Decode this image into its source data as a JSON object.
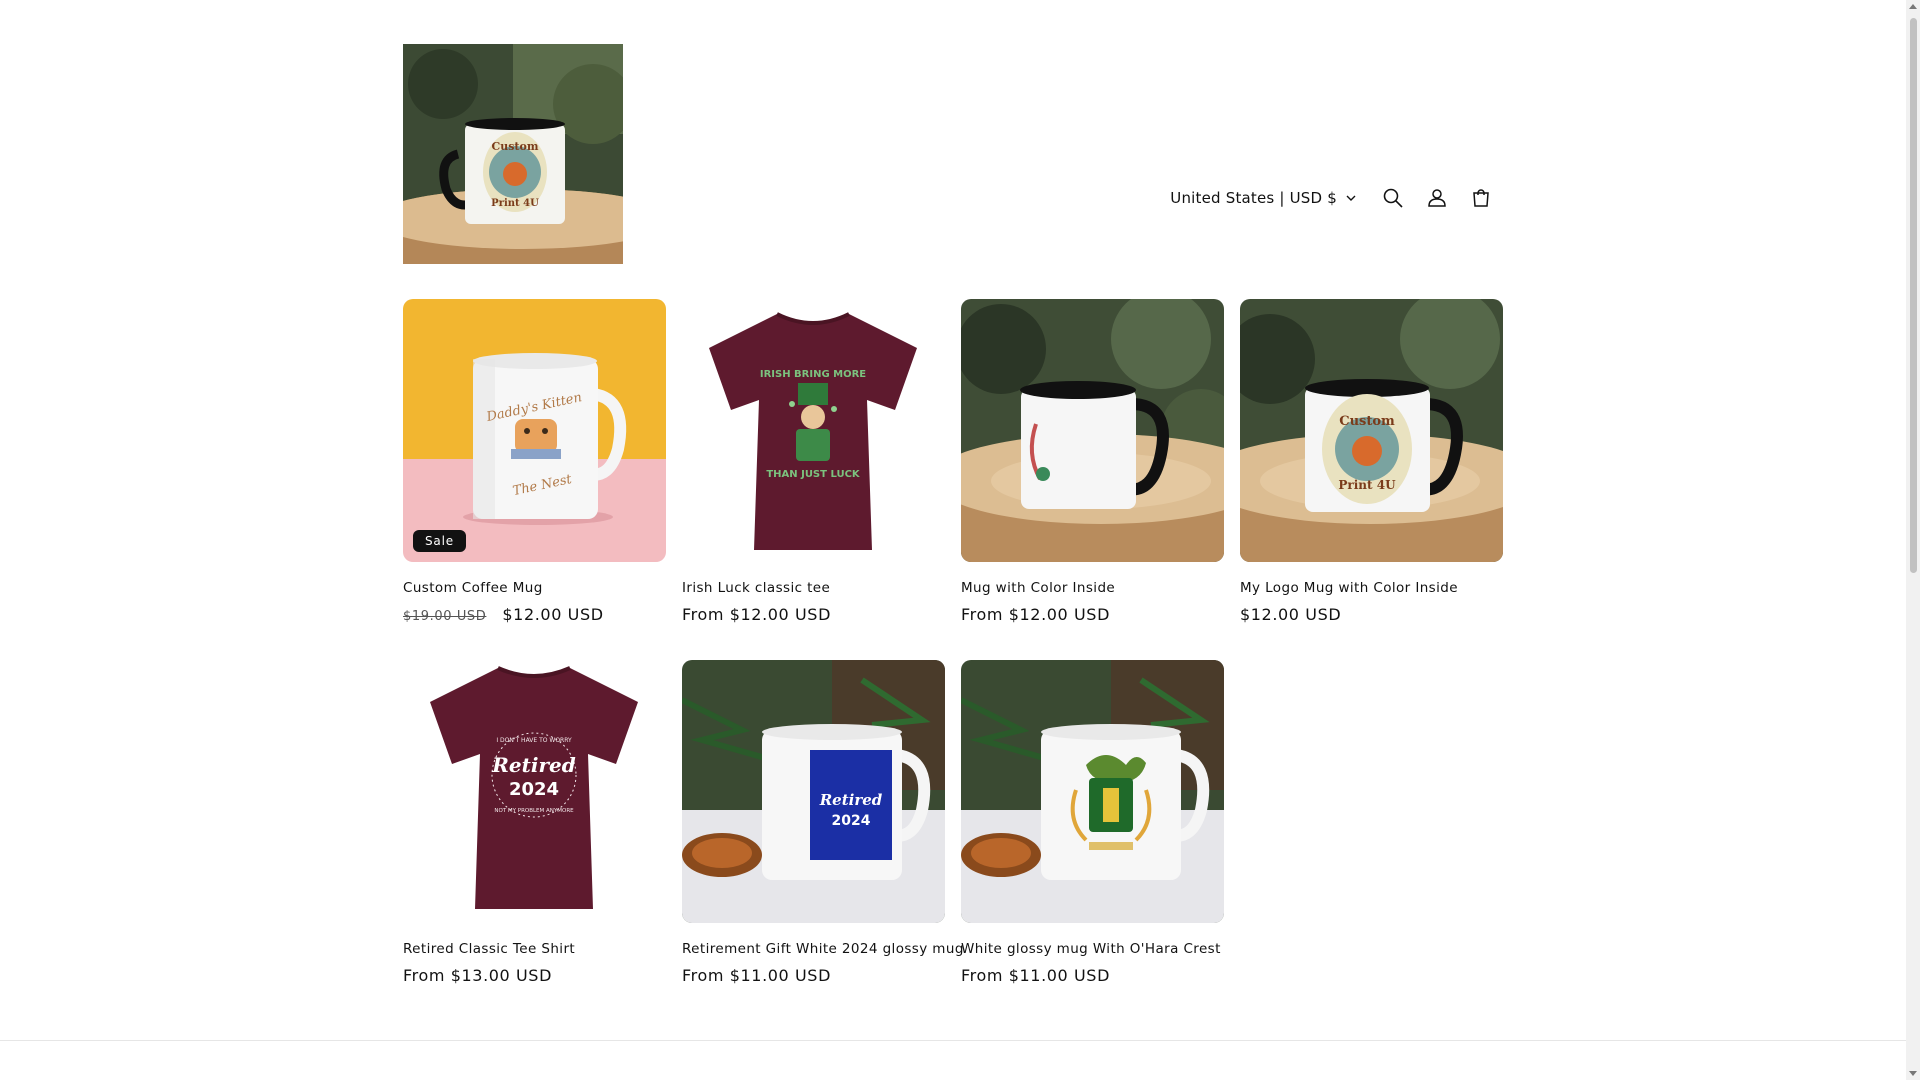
{
  "header": {
    "logo_alt": "Custom Print 4U mug logo",
    "country_selector": "United States | USD $",
    "icons": [
      "search-icon",
      "account-icon",
      "cart-icon"
    ]
  },
  "products": [
    {
      "title": "Custom Coffee Mug",
      "compare_price": "$19.00 USD",
      "price": "$12.00 USD",
      "badge": "Sale",
      "mug_text": [
        "Daddy's Kitten",
        "The Nest"
      ]
    },
    {
      "title": "Irish Luck classic tee",
      "price": "From $12.00 USD",
      "shirt_text": [
        "IRISH BRING MORE",
        "THAN JUST LUCK"
      ]
    },
    {
      "title": "Mug with Color Inside",
      "price": "From $12.00 USD"
    },
    {
      "title": "My Logo Mug with Color Inside",
      "price": "$12.00 USD",
      "mug_text": [
        "Custom",
        "Print 4U"
      ]
    },
    {
      "title": "Retired Classic Tee Shirt",
      "price": "From $13.00 USD",
      "shirt_text": [
        "I DON'T HAVE TO WORRY",
        "Retired",
        "2024",
        "NOT MY PROBLEM ANYMORE"
      ]
    },
    {
      "title": "Retirement Gift White 2024 glossy mug",
      "price": "From $11.00 USD",
      "mug_text": [
        "Retired",
        "2024"
      ]
    },
    {
      "title": "White glossy mug With O'Hara Crest",
      "price": "From $11.00 USD"
    }
  ],
  "colors": {
    "text": "#121212",
    "badge": "#121212",
    "shirt": "#6b1a2a",
    "mug_blue_print": "#1b2fa5",
    "wood": "#d9b88a"
  }
}
